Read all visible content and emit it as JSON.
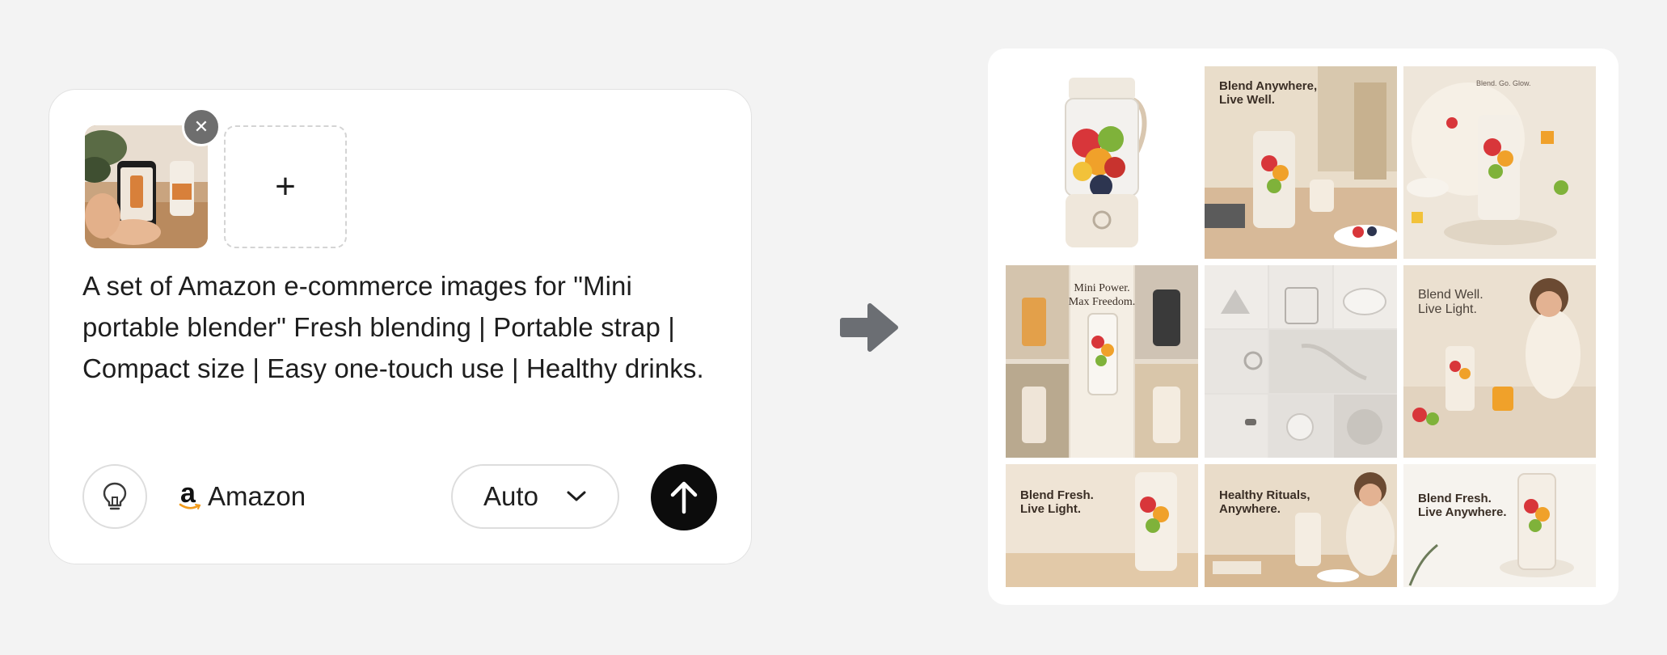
{
  "prompt_card": {
    "remove_glyph": "✕",
    "add_glyph": "+",
    "prompt_text": "A set of Amazon e-commerce images for \"Mini portable blender\" Fresh blending | Portable strap | Compact size | Easy one-touch use | Healthy drinks.",
    "platform": {
      "logo_letter": "a",
      "label": "Amazon",
      "icon": "amazon-logo-icon"
    },
    "mode": {
      "selected": "Auto",
      "icon": "chevron-down-icon"
    },
    "send_icon": "arrow-up-icon",
    "idea_icon": "lightbulb-icon"
  },
  "flow_arrow_icon": "arrow-right-icon",
  "gallery": {
    "tiles": [
      {
        "heading": ""
      },
      {
        "heading": "Blend Anywhere,\nLive Well."
      },
      {
        "heading": "Blend. Go. Glow."
      },
      {
        "heading": "Mini Power.\nMax Freedom."
      },
      {
        "heading": ""
      },
      {
        "heading": "Blend Well.\nLive Light."
      },
      {
        "heading": "Blend Fresh.\nLive Light."
      },
      {
        "heading": "Healthy Rituals,\nAnywhere."
      },
      {
        "heading": "Blend Fresh.\nLive Anywhere."
      }
    ]
  }
}
